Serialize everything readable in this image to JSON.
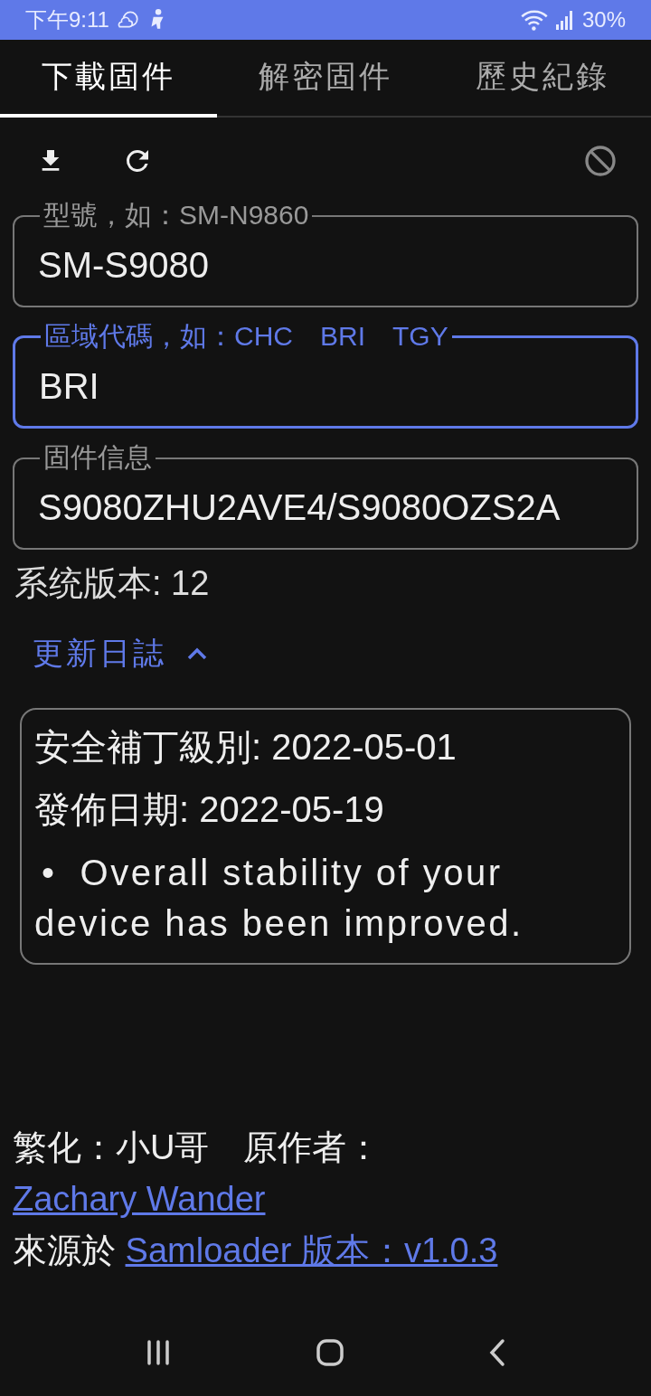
{
  "status_bar": {
    "time": "下午9:11",
    "battery": "30%"
  },
  "tabs": [
    {
      "label": "下載固件",
      "selected": true
    },
    {
      "label": "解密固件",
      "selected": false
    },
    {
      "label": "歷史紀錄",
      "selected": false
    }
  ],
  "toolbar": [
    {
      "kind": "download",
      "disabled": false
    },
    {
      "kind": "refresh",
      "disabled": false
    },
    {
      "kind": "cancel",
      "disabled": true
    }
  ],
  "fields": [
    {
      "label": "型號，如：SM-N9860",
      "value": "SM-S9080",
      "focused": false
    },
    {
      "label": "區域代碼，如：CHC　BRI　TGY",
      "value": "BRI",
      "focused": true
    },
    {
      "label": "固件信息",
      "value": "S9080ZHU2AVE4/S9080OZS2A",
      "focused": false
    }
  ],
  "system_version": "系统版本: 12",
  "changelog": {
    "title": "更新日誌",
    "expanded": true,
    "security_patch": "安全補丁級別: 2022-05-01",
    "release_date": "發佈日期: 2022-05-19",
    "notes": [
      {
        "bullet": "•",
        "text": "Overall stability of your device has been improved."
      }
    ]
  },
  "credits": [
    {
      "text": "繁化：小U哥　原作者：",
      "link": "Zachary Wander"
    },
    {
      "text": "來源於",
      "link": "Samloader 版本：v1.0.3"
    }
  ]
}
